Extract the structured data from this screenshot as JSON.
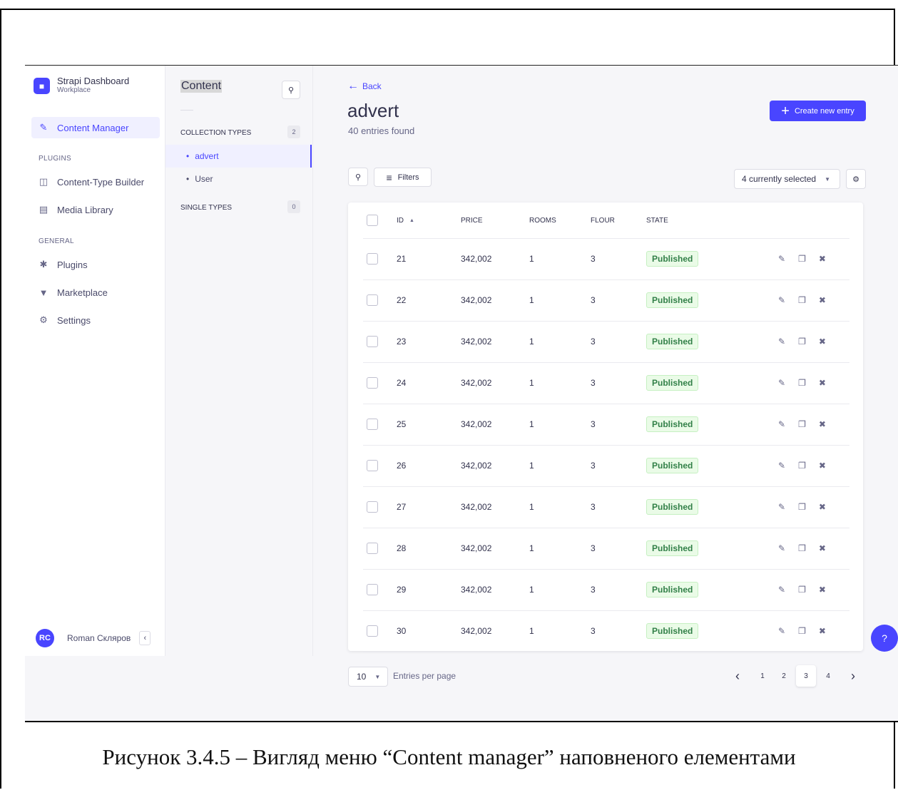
{
  "brand": {
    "title": "Strapi Dashboard",
    "subtitle": "Workplace",
    "logo": "strapi-logo"
  },
  "mainnav": {
    "items": [
      {
        "label": "Content Manager",
        "icon": "edit-icon",
        "active": true
      },
      {
        "label": "Content-Type Builder",
        "icon": "layout-icon"
      },
      {
        "label": "Media Library",
        "icon": "image-icon"
      },
      {
        "label": "Plugins",
        "icon": "puzzle-icon"
      },
      {
        "label": "Marketplace",
        "icon": "cart-icon"
      },
      {
        "label": "Settings",
        "icon": "gear-icon"
      }
    ],
    "sections": {
      "plugins": "PLUGINS",
      "general": "GENERAL"
    }
  },
  "user": {
    "initials": "RC",
    "name": "Roman Скляров",
    "collapse": "‹"
  },
  "subnav": {
    "title": "Content",
    "collection_label": "COLLECTION TYPES",
    "collection_count": "2",
    "single_label": "SINGLE TYPES",
    "single_count": "0",
    "items": [
      {
        "label": "advert",
        "active": true
      },
      {
        "label": "User"
      }
    ]
  },
  "page": {
    "back": "Back",
    "title": "advert",
    "subtitle": "40 entries found",
    "create_label": "Create new entry",
    "filters_label": "Filters",
    "columns_selected": "4 currently selected"
  },
  "table": {
    "headers": [
      "ID",
      "PRICE",
      "ROOMS",
      "FLOUR",
      "STATE"
    ],
    "sort_icon": "▲",
    "rows": [
      {
        "id": "21",
        "price": "342,002",
        "rooms": "1",
        "flour": "3",
        "state": "Published"
      },
      {
        "id": "22",
        "price": "342,002",
        "rooms": "1",
        "flour": "3",
        "state": "Published"
      },
      {
        "id": "23",
        "price": "342,002",
        "rooms": "1",
        "flour": "3",
        "state": "Published"
      },
      {
        "id": "24",
        "price": "342,002",
        "rooms": "1",
        "flour": "3",
        "state": "Published"
      },
      {
        "id": "25",
        "price": "342,002",
        "rooms": "1",
        "flour": "3",
        "state": "Published"
      },
      {
        "id": "26",
        "price": "342,002",
        "rooms": "1",
        "flour": "3",
        "state": "Published"
      },
      {
        "id": "27",
        "price": "342,002",
        "rooms": "1",
        "flour": "3",
        "state": "Published"
      },
      {
        "id": "28",
        "price": "342,002",
        "rooms": "1",
        "flour": "3",
        "state": "Published"
      },
      {
        "id": "29",
        "price": "342,002",
        "rooms": "1",
        "flour": "3",
        "state": "Published"
      },
      {
        "id": "30",
        "price": "342,002",
        "rooms": "1",
        "flour": "3",
        "state": "Published"
      }
    ]
  },
  "pagination": {
    "per_page": "10",
    "per_page_label": "Entries per page",
    "pages": [
      "1",
      "2",
      "3",
      "4"
    ],
    "current": "3"
  },
  "help": "?",
  "caption": "Рисунок 3.4.5 – Вигляд меню “Content manager” наповненого елементами",
  "colors": {
    "primary": "#4945ff",
    "published_bg": "#eafbe7",
    "published_text": "#328048"
  }
}
